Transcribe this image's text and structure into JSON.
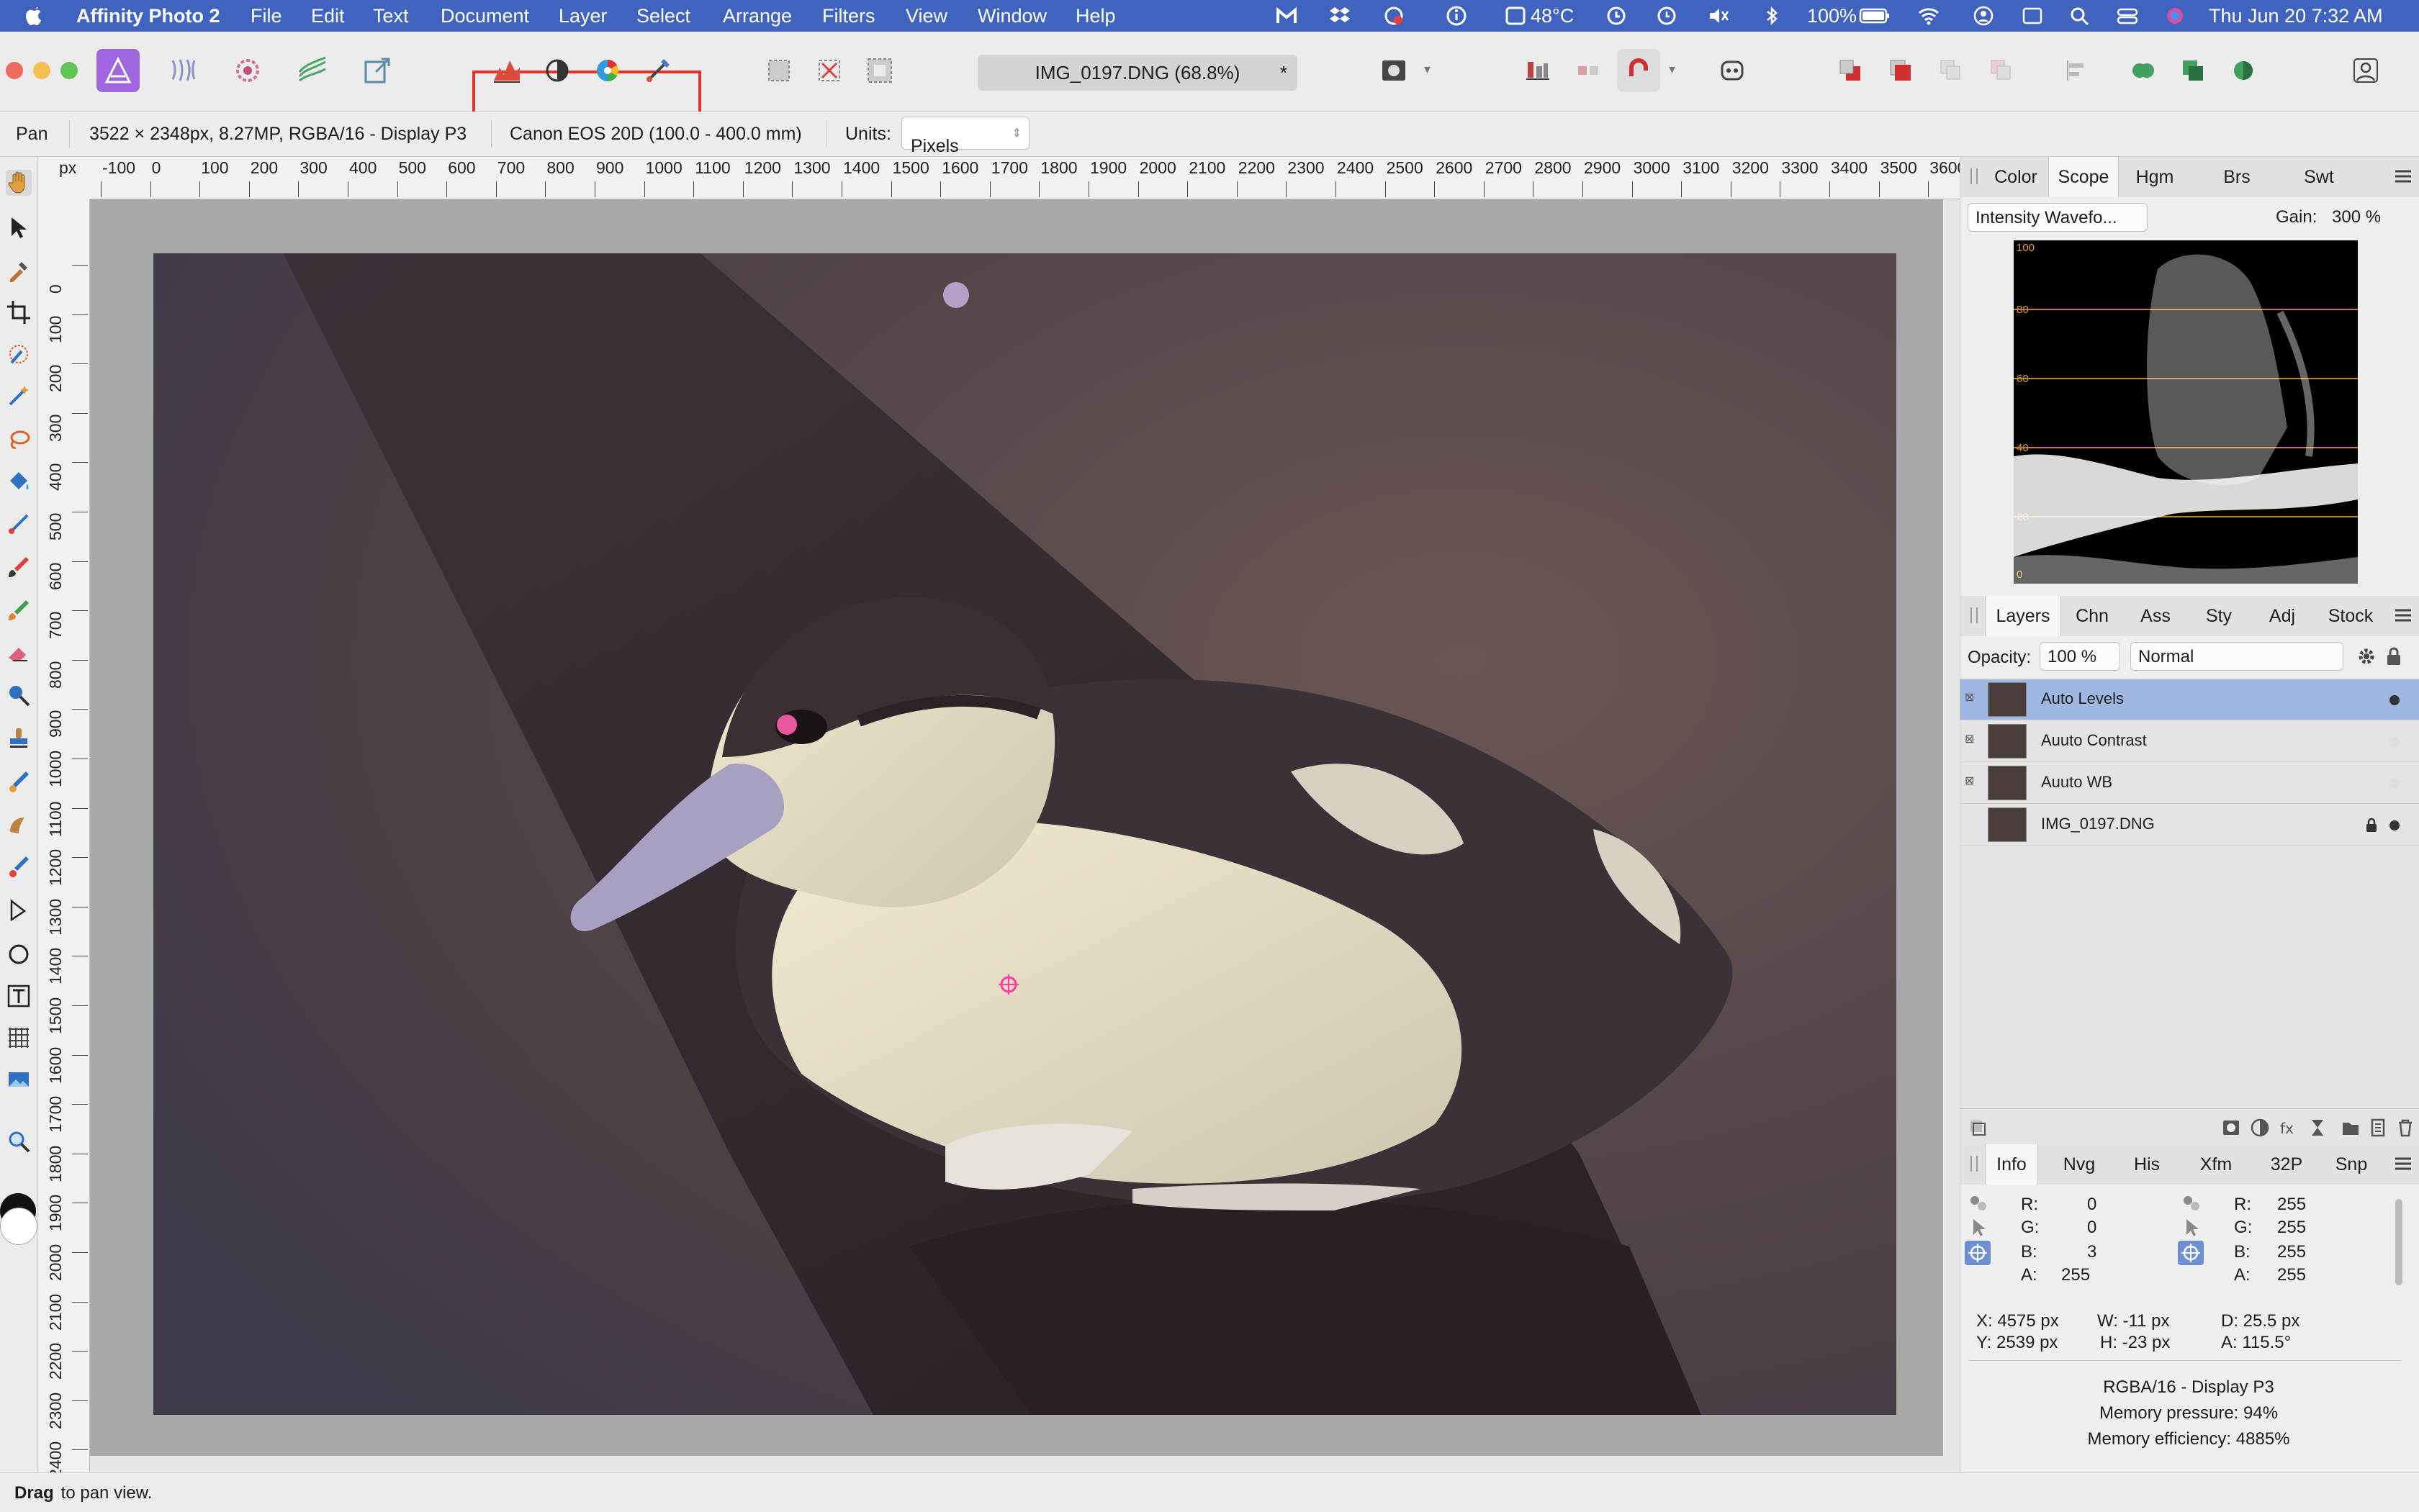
{
  "menubar": {
    "app_name": "Affinity Photo 2",
    "items": [
      "File",
      "Edit",
      "Text",
      "Document",
      "Layer",
      "Select",
      "Arrange",
      "Filters",
      "View",
      "Window",
      "Help"
    ],
    "temperature": "48°C",
    "battery": "100%",
    "clock": "Thu Jun 20  7:32 AM"
  },
  "toolbar": {
    "document_title": "IMG_0197.DNG (68.8%)",
    "modified_marker": "*"
  },
  "contextbar": {
    "tool": "Pan",
    "doc_info": "3522 × 2348px, 8.27MP, RGBA/16 - Display P3",
    "camera": "Canon EOS 20D (100.0 - 400.0 mm)",
    "units_label": "Units:",
    "units_value": "Pixels"
  },
  "rulers": {
    "unit": "px",
    "top_ticks": [
      "-100",
      "0",
      "100",
      "200",
      "300",
      "400",
      "500",
      "600",
      "700",
      "800",
      "900",
      "1000",
      "1100",
      "1200",
      "1300",
      "1400",
      "1500",
      "1600",
      "1700",
      "1800",
      "1900",
      "2000",
      "2100",
      "2200",
      "2300",
      "2400",
      "2500",
      "2600",
      "2700",
      "2800",
      "2900",
      "3000",
      "3100",
      "3200",
      "3300",
      "3400",
      "3500",
      "3600"
    ],
    "left_ticks": [
      "0",
      "100",
      "200",
      "300",
      "400",
      "500",
      "600",
      "700",
      "800",
      "900",
      "1000",
      "1100",
      "1200",
      "1300",
      "1400",
      "1500",
      "1600",
      "1700",
      "1800",
      "1900",
      "2000",
      "2100",
      "2200",
      "2300",
      "2400"
    ]
  },
  "top_panel": {
    "tabs": [
      "Color",
      "Scope",
      "Hgm",
      "Brs",
      "Swt"
    ],
    "active_tab": "Scope",
    "scope_mode": "Intensity Wavefo...",
    "gain_label": "Gain:",
    "gain_value": "300 %",
    "waveform_labels": [
      "100",
      "80",
      "60",
      "40",
      "20",
      "0"
    ]
  },
  "layers_panel": {
    "tabs": [
      "Layers",
      "Chn",
      "Ass",
      "Sty",
      "Adj",
      "Stock"
    ],
    "active_tab": "Layers",
    "opacity_label": "Opacity:",
    "opacity_value": "100 %",
    "blend_mode": "Normal",
    "layers": [
      {
        "name": "Auto Levels",
        "selected": true
      },
      {
        "name": "Auuto Contrast",
        "selected": false
      },
      {
        "name": "Auuto WB",
        "selected": false
      },
      {
        "name": "IMG_0197.DNG",
        "selected": false,
        "locked": true
      }
    ]
  },
  "info_panel": {
    "tabs": [
      "Info",
      "Nvg",
      "His",
      "Xfm",
      "32P",
      "Snp"
    ],
    "active_tab": "Info",
    "left_values": {
      "r_label": "R:",
      "r": "0",
      "g_label": "G:",
      "g": "0",
      "b_label": "B:",
      "b": "3",
      "a_label": "A:",
      "a": "255"
    },
    "right_values": {
      "r_label": "R:",
      "r": "255",
      "g_label": "G:",
      "g": "255",
      "b_label": "B:",
      "b": "255",
      "a_label": "A:",
      "a": "255"
    },
    "pos_x": "X: 4575 px",
    "pos_y": "Y: 2539 px",
    "width": "W: -11 px",
    "height": "H: -23 px",
    "distance": "D: 25.5 px",
    "angle": "A: 115.5°",
    "color_space": "RGBA/16 - Display P3",
    "memory_pressure": "Memory pressure: 94%",
    "memory_efficiency": "Memory efficiency: 4885%"
  },
  "statusbar": {
    "bold": "Drag",
    "text": " to pan view."
  },
  "colors": {
    "menubar_bg": "#3f63bf",
    "selection": "#9eb8e3",
    "highlight_box": "#e0332b",
    "app_icon": "#a066e0"
  }
}
